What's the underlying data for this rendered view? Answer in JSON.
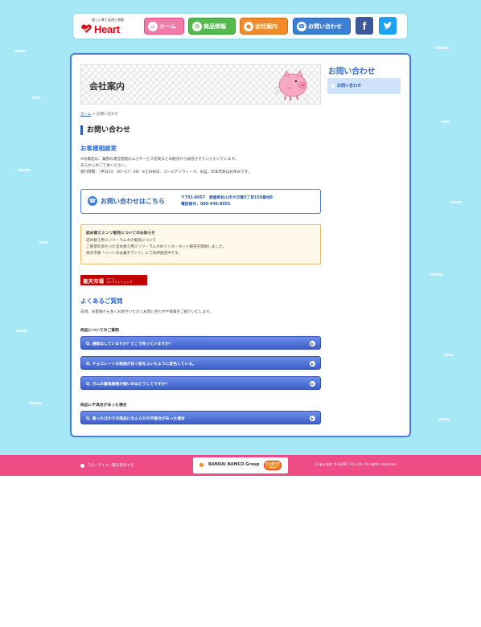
{
  "header": {
    "logo_tagline": "美しい夢と笑顔と感動",
    "logo_text": "Heart",
    "nav": [
      {
        "label": "ホーム",
        "icon": "home-icon"
      },
      {
        "label": "商品情報",
        "icon": "product-icon"
      },
      {
        "label": "会社案内",
        "icon": "company-icon"
      },
      {
        "label": "お問い合わせ",
        "icon": "phone-icon"
      }
    ],
    "social": {
      "facebook": "f",
      "twitter": "t"
    }
  },
  "banner": {
    "title": "会社案内"
  },
  "breadcrumb": {
    "home": "ホーム",
    "sep": " > ",
    "current": "お問い合わせ"
  },
  "page_title": "お問い合わせ",
  "customer_section": {
    "heading": "お客様相談室",
    "lines": [
      "※お電話は、業務の運営管理およびサービス充実などの観点から録音させていただいています。",
      "あらかじめご了承ください。",
      "受付時間：（平日10：00～17：00）※土日祝日、ゴールデンウィーク、お盆、年末年始はお休みです。"
    ]
  },
  "contact_box": {
    "cta": "お問い合わせはこちら",
    "address": "〒791-8057　愛媛県松山市大可賀3丁目150番地8",
    "phone": "電話番号：089-946-8955"
  },
  "notice": {
    "title": "詰め替えミンツ販売についてのお知らせ",
    "lines": [
      "詰め替え用ミンツ・ラムネの販売について",
      "ご要望の多かった詰め替え用ミンツ・ラムネのインターネット販売を開始しました。",
      "楽天市場「ハートのお菓子ランド」にて好評発売中です。"
    ]
  },
  "rakuten": {
    "name": "楽天市場",
    "sub_top": "ハート",
    "sub_bottom": "オンラインショップ"
  },
  "faq_section": {
    "heading": "よくあるご質問",
    "intro": "日頃、お客様から多くお寄せいただくお問い合わせや情報をご紹介いたします。",
    "categories": [
      {
        "title": "商品についてのご質問",
        "items": [
          "Q. 通販はしていますか？どこで売っていますか？",
          "Q. チョコレートの表面が白く粉をふいたように変色している。",
          "Q. ガムの賞味期限が無いのはどうしてですか？"
        ]
      },
      {
        "title": "商品に不具合があった場合",
        "items": [
          "Q. 買ったばかりの商品になんらかの不都合があった場合"
        ]
      }
    ]
  },
  "sidebar": {
    "heading": "お問い合わせ",
    "items": [
      {
        "label": "お問い合わせ"
      }
    ]
  },
  "footer": {
    "lyrics_link": "コピーライト一覧を表示する",
    "group_text": "BANDAI NAMCO Group",
    "group_logo": "バンダイナムコ",
    "copyright": "Copyright ©HEART CO.,Ltd. All rights reserved."
  }
}
